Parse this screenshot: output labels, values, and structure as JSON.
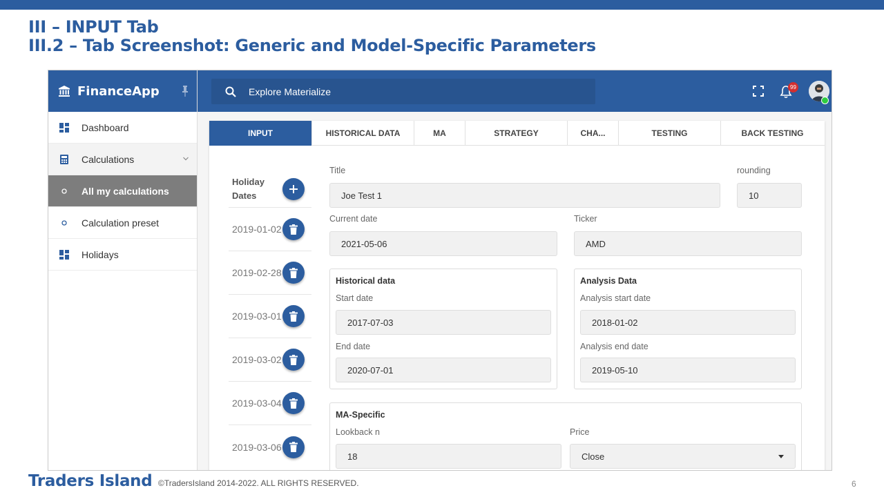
{
  "slide": {
    "title_line1": "III – INPUT Tab",
    "title_line2": "III.2 – Tab Screenshot: Generic and Model-Specific Parameters",
    "footer_brand": "Traders Island",
    "footer_copy": "©TradersIsland 2014-2022. ALL RIGHTS RESERVED.",
    "page_number": "6"
  },
  "app": {
    "name": "FinanceApp",
    "search_placeholder": "Explore Materialize",
    "notification_count": "99"
  },
  "sidebar": {
    "items": [
      {
        "label": "Dashboard",
        "icon": "dashboard-icon"
      },
      {
        "label": "Calculations",
        "icon": "calculator-icon"
      },
      {
        "label": "All my calculations",
        "icon": "circle-icon"
      },
      {
        "label": "Calculation preset",
        "icon": "circle-icon"
      },
      {
        "label": "Holidays",
        "icon": "dashboard-icon"
      }
    ]
  },
  "tabs": [
    "INPUT",
    "HISTORICAL DATA",
    "MA",
    "STRATEGY",
    "CHA...",
    "TESTING",
    "BACK TESTING"
  ],
  "holidays": {
    "header": "Holiday Dates",
    "dates": [
      "2019-01-02",
      "2019-02-28",
      "2019-03-01",
      "2019-03-02",
      "2019-03-04",
      "2019-03-06"
    ]
  },
  "form": {
    "title_label": "Title",
    "title_value": "Joe Test 1",
    "rounding_label": "rounding",
    "rounding_value": "10",
    "current_date_label": "Current date",
    "current_date_value": "2021-05-06",
    "ticker_label": "Ticker",
    "ticker_value": "AMD",
    "historical": {
      "heading": "Historical data",
      "start_label": "Start date",
      "start_value": "2017-07-03",
      "end_label": "End date",
      "end_value": "2020-07-01"
    },
    "analysis": {
      "heading": "Analysis Data",
      "start_label": "Analysis start date",
      "start_value": "2018-01-02",
      "end_label": "Analysis end date",
      "end_value": "2019-05-10"
    },
    "ma": {
      "heading": "MA-Specific",
      "lookback_label": "Lookback n",
      "lookback_value": "18",
      "price_label": "Price",
      "price_value": "Close"
    }
  },
  "colors": {
    "brand": "#2c5d9f",
    "active_nav": "#7d7d7d",
    "badge": "#d32f2f",
    "online": "#2ecc40"
  }
}
